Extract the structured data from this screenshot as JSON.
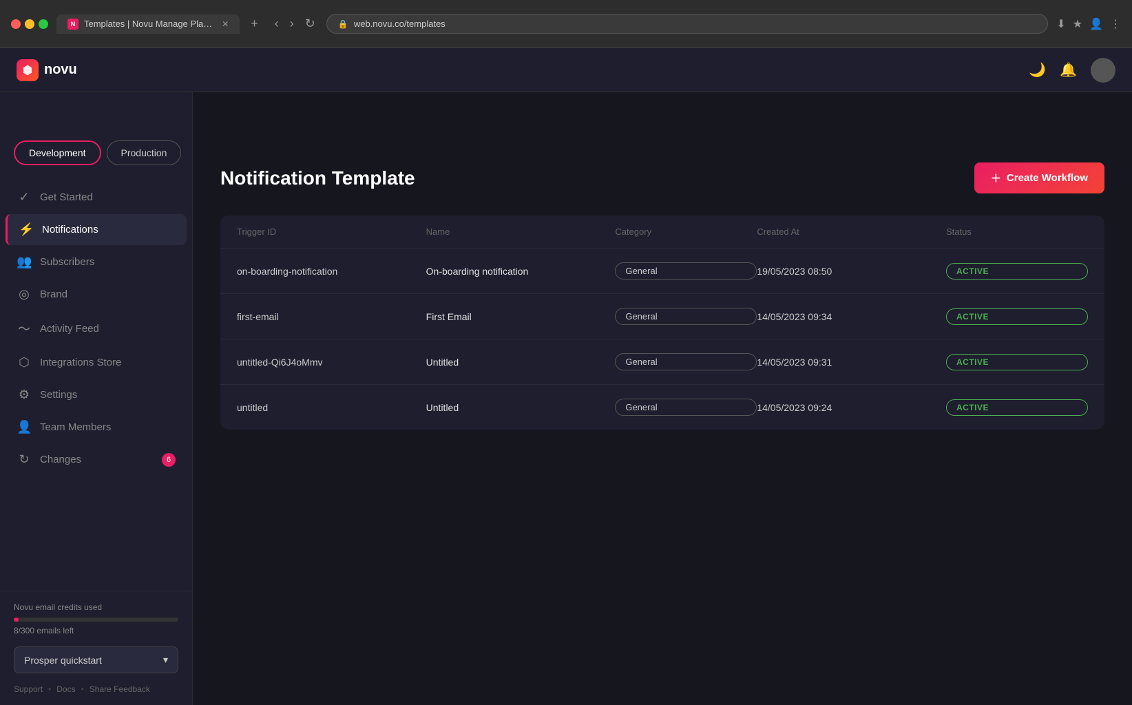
{
  "browser": {
    "tab_title": "Templates | Novu Manage Pla…",
    "url": "web.novu.co/templates",
    "tab_favicon": "N"
  },
  "topbar": {
    "logo_text": "novu",
    "logo_icon": "N"
  },
  "sidebar": {
    "env_buttons": [
      {
        "label": "Development",
        "active": true
      },
      {
        "label": "Production",
        "active": false
      }
    ],
    "nav_items": [
      {
        "icon": "✓",
        "label": "Get Started",
        "active": false,
        "badge": null,
        "icon_name": "check-circle-icon"
      },
      {
        "icon": "⚡",
        "label": "Notifications",
        "active": true,
        "badge": null,
        "icon_name": "notifications-icon"
      },
      {
        "icon": "👥",
        "label": "Subscribers",
        "active": false,
        "badge": null,
        "icon_name": "subscribers-icon"
      },
      {
        "icon": "◎",
        "label": "Brand",
        "active": false,
        "badge": null,
        "icon_name": "brand-icon"
      },
      {
        "icon": "📡",
        "label": "Activity Feed",
        "active": false,
        "badge": null,
        "icon_name": "activity-feed-icon"
      },
      {
        "icon": "🔗",
        "label": "Integrations Store",
        "active": false,
        "badge": null,
        "icon_name": "integrations-icon"
      },
      {
        "icon": "⚙",
        "label": "Settings",
        "active": false,
        "badge": null,
        "icon_name": "settings-icon"
      },
      {
        "icon": "👤",
        "label": "Team Members",
        "active": false,
        "badge": null,
        "icon_name": "team-members-icon"
      },
      {
        "icon": "↻",
        "label": "Changes",
        "active": false,
        "badge": "6",
        "icon_name": "changes-icon"
      }
    ],
    "email_credits_label": "Novu email credits used",
    "emails_left": "8/300 emails left",
    "progress_percent": 3,
    "workspace": "Prosper quickstart",
    "footer_links": [
      "Support",
      "Docs",
      "Share Feedback"
    ]
  },
  "main": {
    "page_title": "Notification Template",
    "create_btn_label": "Create Workflow",
    "table": {
      "columns": [
        "Trigger ID",
        "Name",
        "Category",
        "Created At",
        "Status"
      ],
      "rows": [
        {
          "trigger_id": "on-boarding-notification",
          "name": "On-boarding notification",
          "category": "General",
          "created_at": "19/05/2023 08:50",
          "status": "ACTIVE"
        },
        {
          "trigger_id": "first-email",
          "name": "First Email",
          "category": "General",
          "created_at": "14/05/2023 09:34",
          "status": "ACTIVE"
        },
        {
          "trigger_id": "untitled-Qi6J4oMmv",
          "name": "Untitled",
          "category": "General",
          "created_at": "14/05/2023 09:31",
          "status": "ACTIVE"
        },
        {
          "trigger_id": "untitled",
          "name": "Untitled",
          "category": "General",
          "created_at": "14/05/2023 09:24",
          "status": "ACTIVE"
        }
      ]
    }
  }
}
